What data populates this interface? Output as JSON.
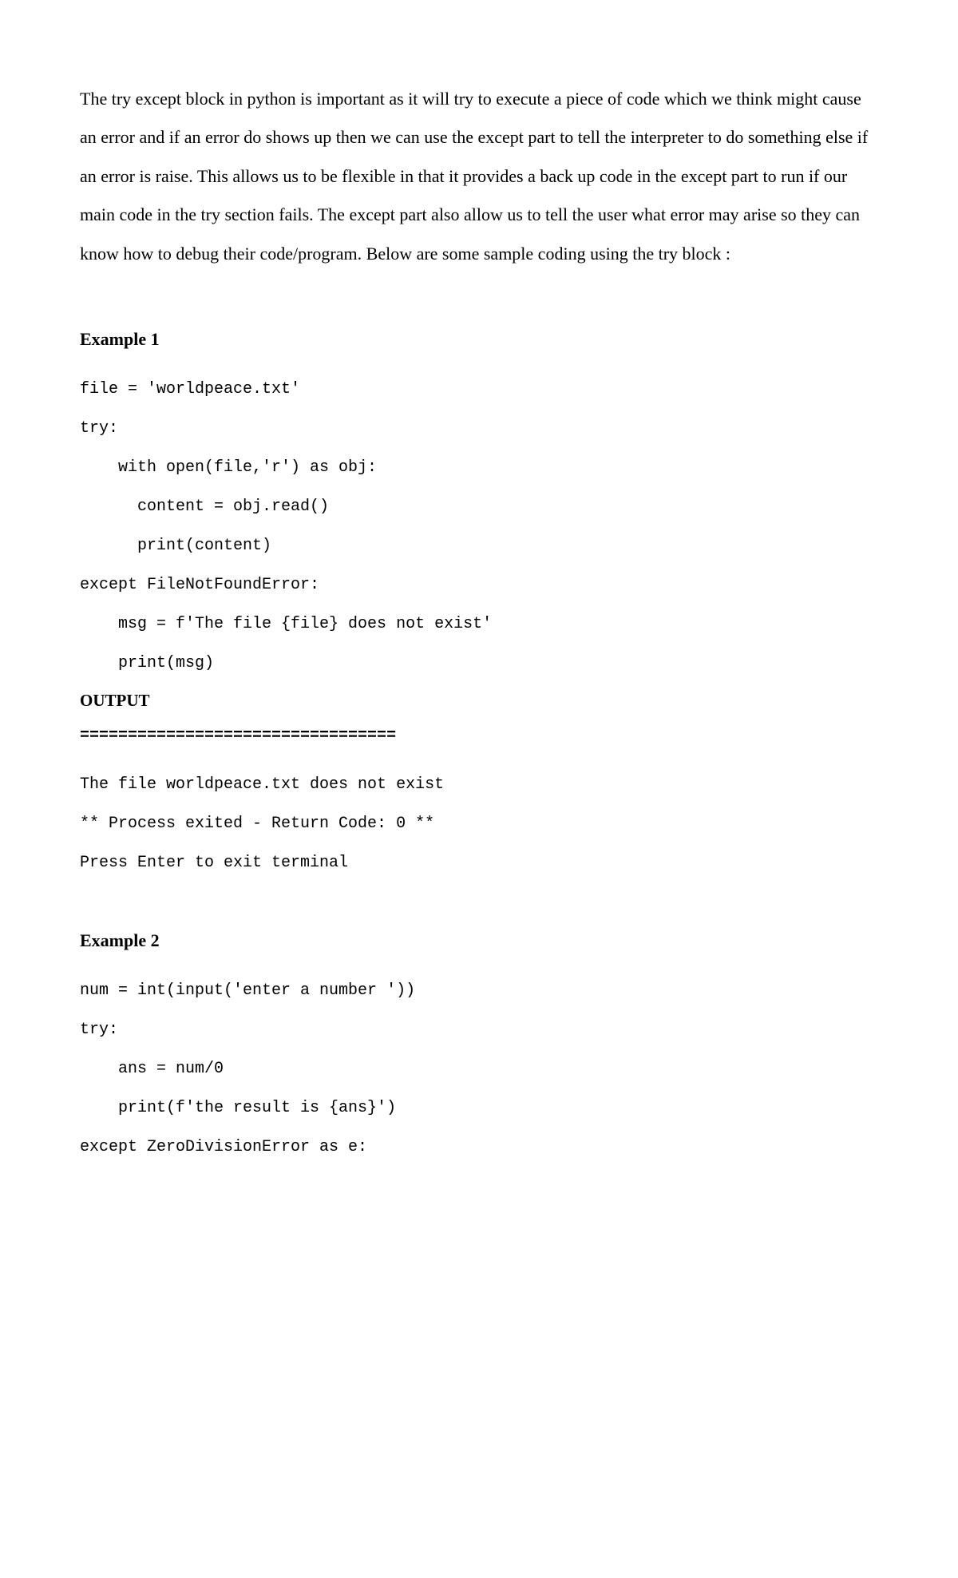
{
  "intro": "The try except block in python is important as it will try to execute a piece of code which we think might cause an error and if an error do shows up then we can use the except part to tell the interpreter to do something else if an error is raise. This allows us to be flexible in that it provides a back up code in the except part to run if our main code in the try section fails. The except part also allow us to tell the user what error may arise so they can know how to debug their code/program.  Below are some sample coding using the try block :",
  "example1": {
    "heading": "Example 1",
    "code": "file = 'worldpeace.txt'\ntry:\n    with open(file,'r') as obj:\n      content = obj.read()\n      print(content)\nexcept FileNotFoundError:\n    msg = f'The file {file} does not exist'\n    print(msg)",
    "output_heading": "OUTPUT",
    "divider": "=================================",
    "output": "The file worldpeace.txt does not exist\n** Process exited - Return Code: 0 **\nPress Enter to exit terminal"
  },
  "example2": {
    "heading": "Example 2",
    "code": "num = int(input('enter a number '))\ntry:\n    ans = num/0\n    print(f'the result is {ans}')\nexcept ZeroDivisionError as e:"
  }
}
